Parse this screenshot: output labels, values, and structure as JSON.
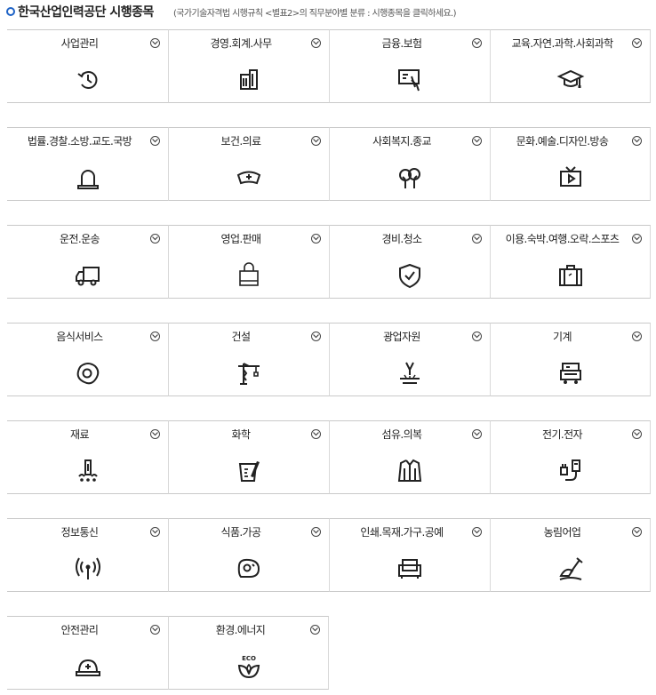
{
  "header": {
    "title": "한국산업인력공단 시행종목",
    "note": "(국가기술자격법 시행규칙 <별표2>의 직무분야별 분류 : 시행종목을 클릭하세요.)"
  },
  "categories": [
    {
      "label": "사업관리",
      "icon": "clock-icon"
    },
    {
      "label": "경영.회계.사무",
      "icon": "building-icon"
    },
    {
      "label": "금융.보험",
      "icon": "board-hand-icon"
    },
    {
      "label": "교육.자연.과학.사회과학",
      "icon": "graduation-cap-icon"
    },
    {
      "label": "법률.경찰.소방.교도.국방",
      "icon": "siren-icon"
    },
    {
      "label": "보건.의료",
      "icon": "nurse-cap-icon"
    },
    {
      "label": "사회복지.종교",
      "icon": "trees-icon"
    },
    {
      "label": "문화.예술.디자인.방송",
      "icon": "tv-icon"
    },
    {
      "label": "운전.운송",
      "icon": "truck-icon"
    },
    {
      "label": "영업.판매",
      "icon": "shopping-bag-icon"
    },
    {
      "label": "경비.청소",
      "icon": "shield-icon"
    },
    {
      "label": "이용.숙박.여행.오락.스포츠",
      "icon": "suitcase-icon"
    },
    {
      "label": "음식서비스",
      "icon": "fried-egg-icon"
    },
    {
      "label": "건설",
      "icon": "crane-icon"
    },
    {
      "label": "광업자원",
      "icon": "drill-icon"
    },
    {
      "label": "기계",
      "icon": "machine-icon"
    },
    {
      "label": "재료",
      "icon": "material-icon"
    },
    {
      "label": "화학",
      "icon": "beaker-icon"
    },
    {
      "label": "섬유.의복",
      "icon": "jacket-icon"
    },
    {
      "label": "전기.전자",
      "icon": "plug-icon"
    },
    {
      "label": "정보통신",
      "icon": "antenna-icon"
    },
    {
      "label": "식품.가공",
      "icon": "meat-icon"
    },
    {
      "label": "인쇄.목재.가구.공예",
      "icon": "sofa-icon"
    },
    {
      "label": "농림어업",
      "icon": "shovel-icon"
    },
    {
      "label": "안전관리",
      "icon": "hard-hat-icon"
    },
    {
      "label": "환경.에너지",
      "icon": "eco-leaf-icon"
    }
  ],
  "eco_text": "ECO",
  "colors": {
    "bullet": "#1f63c6",
    "border": "#c9c9c9",
    "text": "#222222"
  }
}
